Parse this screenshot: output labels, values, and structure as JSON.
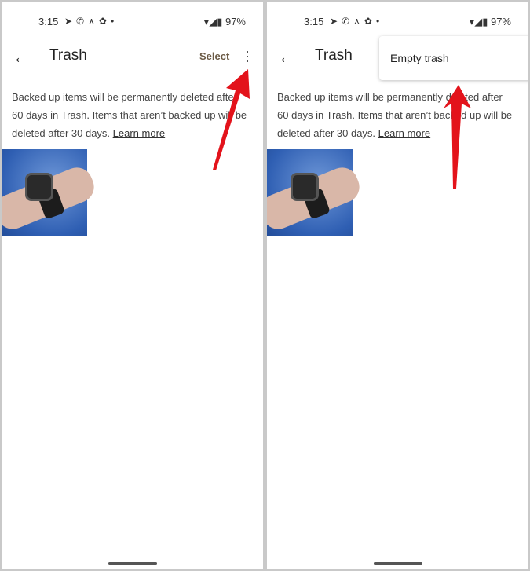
{
  "status": {
    "time": "3:15",
    "battery": "97%",
    "icons": [
      "telegram-icon",
      "whatsapp-icon",
      "app-icon",
      "app-icon",
      "dot-icon"
    ],
    "right_icons": [
      "wifi-icon",
      "signal-icon",
      "battery-icon"
    ]
  },
  "header": {
    "title": "Trash",
    "select": "Select"
  },
  "description": "Backed up items will be permanently deleted after 60 days in Trash. Items that aren’t backed up will be deleted after 30 days.",
  "learn_more": "Learn more",
  "menu": {
    "items": [
      "Empty trash"
    ]
  },
  "colors": {
    "arrow": "#e3131b",
    "select": "#6b5a45"
  }
}
